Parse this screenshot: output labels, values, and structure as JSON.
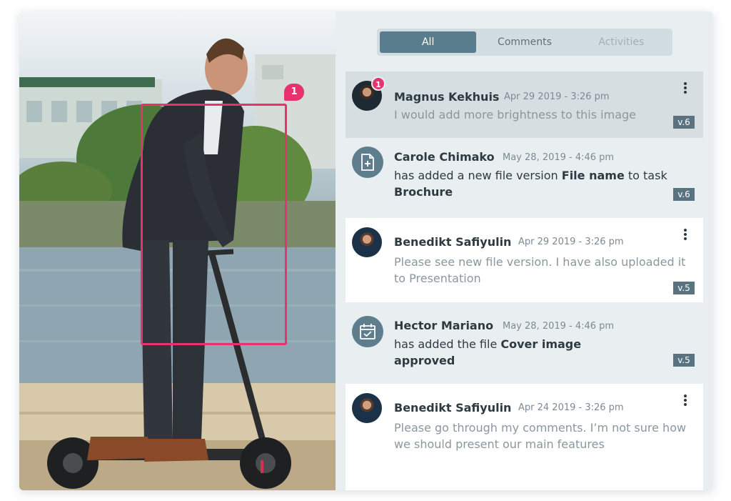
{
  "colors": {
    "accent": "#e6326e",
    "tab_active": "#5a7d8e",
    "version_badge": "#5a7381",
    "panel_bg": "#e9eff1"
  },
  "image_annotation": {
    "badge": "1"
  },
  "tabs": [
    {
      "label": "All",
      "active": true
    },
    {
      "label": "Comments",
      "active": false
    },
    {
      "label": "Activities",
      "active": false
    }
  ],
  "feed": [
    {
      "type": "comment",
      "name": "Magnus Kekhuis",
      "date": "Apr 29 2019 - 3:26 pm",
      "text": "I would add more brightness to this image",
      "badge": "1",
      "version": "v.6",
      "icon": "avatar"
    },
    {
      "type": "activity",
      "name": "Carole Chimako",
      "date": "May 28, 2019 - 4:46 pm",
      "text_pre": "has added a new file version ",
      "text_bold1": "File name",
      "text_mid": " to task ",
      "text_bold2": "Brochure",
      "version": "v.6",
      "icon": "file-add-icon"
    },
    {
      "type": "comment",
      "name": "Benedikt Safiyulin",
      "date": "Apr 29 2019 - 3:26 pm",
      "text": "Please see new file version. I have also uploaded it to Presentation",
      "version": "v.5",
      "icon": "avatar"
    },
    {
      "type": "activity",
      "name": "Hector Mariano",
      "date": "May 28, 2019 - 4:46 pm",
      "text_pre": "has added the file ",
      "text_bold1": "Cover image",
      "text_mid": " ",
      "text_bold2": "approved",
      "version": "v.5",
      "icon": "calendar-check-icon"
    },
    {
      "type": "comment",
      "name": "Benedikt Safiyulin",
      "date": "Apr 24 2019 - 3:26 pm",
      "text": "Please go through my comments. I’m not sure how we should present our main features",
      "icon": "avatar"
    }
  ]
}
